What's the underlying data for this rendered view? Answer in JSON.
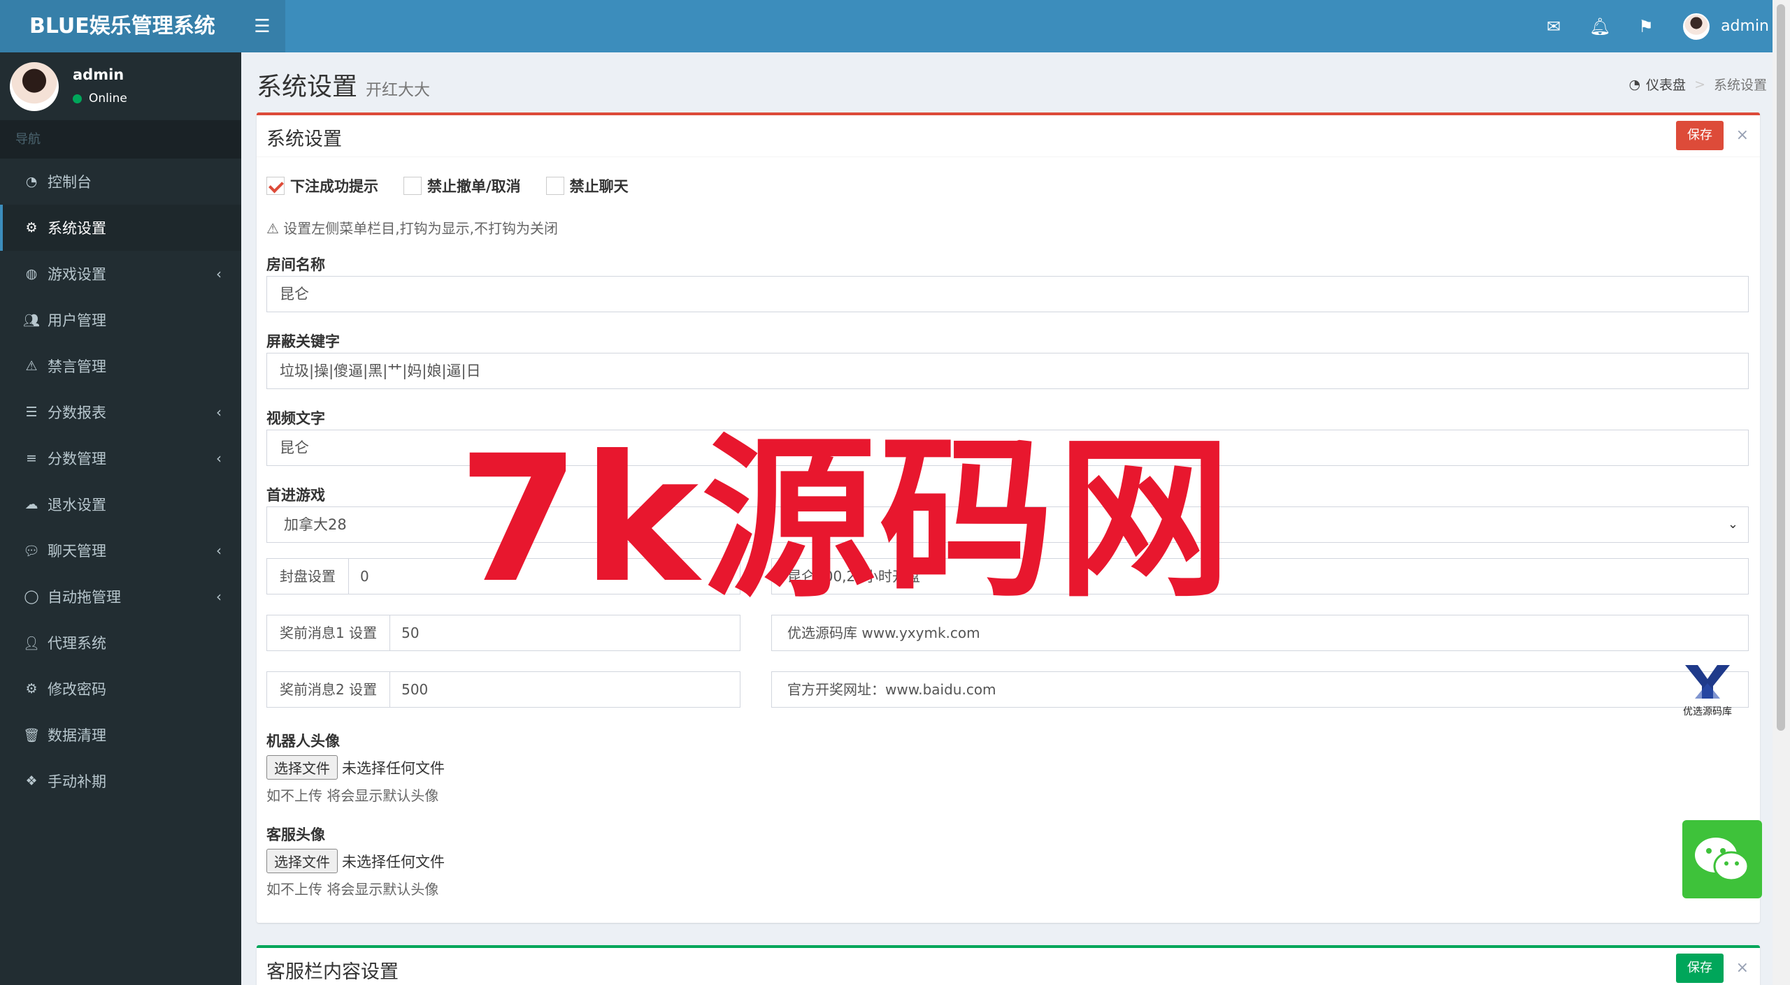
{
  "app": {
    "title": "BLUE娱乐管理系统"
  },
  "topbar": {
    "user_name": "admin"
  },
  "user_panel": {
    "name": "admin",
    "status": "Online"
  },
  "nav": {
    "header": "导航",
    "items": [
      {
        "label": "控制台",
        "icon": "dashboard-icon",
        "arrow": false
      },
      {
        "label": "系统设置",
        "icon": "cogs-icon",
        "arrow": false,
        "active": true
      },
      {
        "label": "游戏设置",
        "icon": "gamepad-icon",
        "arrow": true
      },
      {
        "label": "用户管理",
        "icon": "users-icon",
        "arrow": false
      },
      {
        "label": "禁言管理",
        "icon": "warning-icon",
        "arrow": false
      },
      {
        "label": "分数报表",
        "icon": "list-icon",
        "arrow": true
      },
      {
        "label": "分数管理",
        "icon": "database-icon",
        "arrow": true
      },
      {
        "label": "退水设置",
        "icon": "cloud-download-icon",
        "arrow": false
      },
      {
        "label": "聊天管理",
        "icon": "chat-icon",
        "arrow": true
      },
      {
        "label": "自动拖管理",
        "icon": "comment-icon",
        "arrow": true
      },
      {
        "label": "代理系统",
        "icon": "user-plus-icon",
        "arrow": false
      },
      {
        "label": "修改密码",
        "icon": "gear-icon",
        "arrow": false
      },
      {
        "label": "数据清理",
        "icon": "trash-icon",
        "arrow": false
      },
      {
        "label": "手动补期",
        "icon": "cubes-icon",
        "arrow": false
      }
    ]
  },
  "page": {
    "title": "系统设置",
    "subtitle": "开红大大"
  },
  "breadcrumb": {
    "home": "仪表盘",
    "current": "系统设置",
    "separator": ">"
  },
  "settings_box": {
    "title": "系统设置",
    "save_label": "保存",
    "close_label": "×",
    "checkboxes": [
      {
        "label": "下注成功提示",
        "checked": true
      },
      {
        "label": "禁止撤单/取消",
        "checked": false
      },
      {
        "label": "禁止聊天",
        "checked": false
      }
    ],
    "hint": "设置左侧菜单栏目,打钩为显示,不打钩为关闭",
    "room_name": {
      "label": "房间名称",
      "value": "昆仑"
    },
    "blocked_words": {
      "label": "屏蔽关键字",
      "value": "垃圾|操|傻逼|黑|艹|妈|娘|逼|日"
    },
    "video_text": {
      "label": "视频文字",
      "value": "昆仑"
    },
    "first_game": {
      "label": "首进游戏",
      "value": "加拿大28"
    },
    "close_setting": {
      "label": "封盘设置",
      "value": "0",
      "note": "昆仑700,24小时开盘"
    },
    "pre_msg_1": {
      "label": "奖前消息1 设置",
      "value": "50",
      "text": "优选源码库  www.yxymk.com"
    },
    "pre_msg_2": {
      "label": "奖前消息2 设置",
      "value": "500",
      "text": "官方开奖网址：www.baidu.com"
    },
    "robot_avatar": {
      "label": "机器人头像",
      "button": "选择文件",
      "status": "未选择任何文件",
      "hint": "如不上传 将会显示默认头像"
    },
    "service_avatar": {
      "label": "客服头像",
      "button": "选择文件",
      "status": "未选择任何文件",
      "hint": "如不上传 将会显示默认头像"
    }
  },
  "service_box": {
    "title": "客服栏内容设置",
    "save_label": "保存",
    "close_label": "×"
  },
  "watermark": {
    "text": "7k源码网"
  },
  "side_logo": {
    "text": "优选源码库"
  },
  "colors": {
    "primary": "#3c8dbc",
    "sidebar": "#222d32",
    "danger": "#dd4b39",
    "success": "#00a65a",
    "watermark": "#e8172e"
  }
}
